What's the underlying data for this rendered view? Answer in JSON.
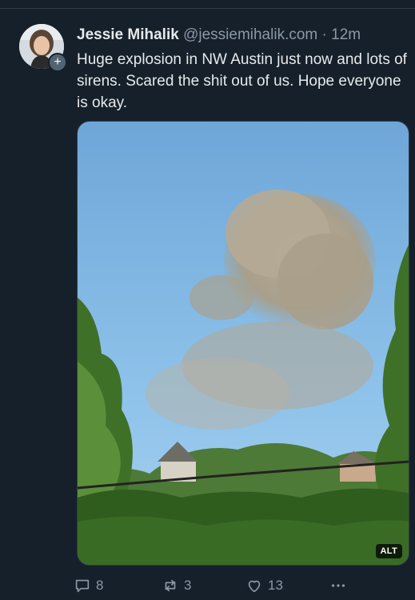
{
  "tweet": {
    "author": {
      "name": "Jessie Mihalik",
      "handle": "@jessiemihalik.com",
      "separator": "·",
      "time": "12m",
      "follow_icon": "plus-icon"
    },
    "text": "Huge explosion in NW Austin just now and lots of sirens. Scared the shit out of us. Hope everyone is okay.",
    "media": {
      "alt_badge": "ALT"
    },
    "actions": {
      "reply_count": "8",
      "retweet_count": "3",
      "like_count": "13",
      "more_icon": "ellipsis-icon"
    }
  },
  "colors": {
    "background": "#15202b",
    "text": "#e7e9ea",
    "secondary": "#8b98a5"
  }
}
